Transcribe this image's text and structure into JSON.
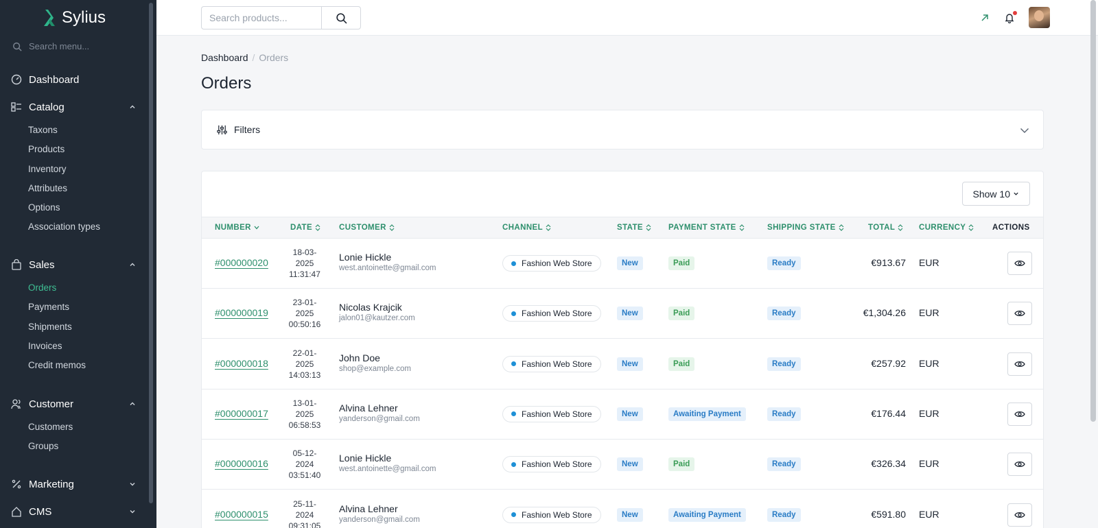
{
  "brand": {
    "name": "Sylius"
  },
  "sidebar": {
    "search_placeholder": "Search menu...",
    "dashboard": "Dashboard",
    "catalog": {
      "label": "Catalog",
      "items": [
        "Taxons",
        "Products",
        "Inventory",
        "Attributes",
        "Options",
        "Association types"
      ]
    },
    "sales": {
      "label": "Sales",
      "items": [
        "Orders",
        "Payments",
        "Shipments",
        "Invoices",
        "Credit memos"
      ],
      "active": "Orders"
    },
    "customer": {
      "label": "Customer",
      "items": [
        "Customers",
        "Groups"
      ]
    },
    "marketing": "Marketing",
    "cms": "CMS"
  },
  "topbar": {
    "search_placeholder": "Search products..."
  },
  "breadcrumb": {
    "root": "Dashboard",
    "current": "Orders"
  },
  "page": {
    "title": "Orders",
    "filters_label": "Filters",
    "show_label": "Show 10"
  },
  "colors": {
    "accent": "#2d8f6c",
    "sidebar": "#212a35",
    "badge_blue": "#2a7cc5",
    "badge_green": "#3a9c56"
  },
  "table": {
    "columns": [
      "NUMBER",
      "DATE",
      "CUSTOMER",
      "CHANNEL",
      "STATE",
      "PAYMENT STATE",
      "SHIPPING STATE",
      "TOTAL",
      "CURRENCY",
      "ACTIONS"
    ],
    "rows": [
      {
        "number": "#000000020",
        "date": [
          "18-03-",
          "2025",
          "11:31:47"
        ],
        "customer": "Lonie Hickle",
        "email": "west.antoinette@gmail.com",
        "channel": "Fashion Web Store",
        "state": "New",
        "payment": "Paid",
        "shipping": "Ready",
        "total": "€913.67",
        "currency": "EUR"
      },
      {
        "number": "#000000019",
        "date": [
          "23-01-",
          "2025",
          "00:50:16"
        ],
        "customer": "Nicolas Krajcik",
        "email": "jalon01@kautzer.com",
        "channel": "Fashion Web Store",
        "state": "New",
        "payment": "Paid",
        "shipping": "Ready",
        "total": "€1,304.26",
        "currency": "EUR"
      },
      {
        "number": "#000000018",
        "date": [
          "22-01-",
          "2025",
          "14:03:13"
        ],
        "customer": "John Doe",
        "email": "shop@example.com",
        "channel": "Fashion Web Store",
        "state": "New",
        "payment": "Paid",
        "shipping": "Ready",
        "total": "€257.92",
        "currency": "EUR"
      },
      {
        "number": "#000000017",
        "date": [
          "13-01-",
          "2025",
          "06:58:53"
        ],
        "customer": "Alvina Lehner",
        "email": "yanderson@gmail.com",
        "channel": "Fashion Web Store",
        "state": "New",
        "payment": "Awaiting Payment",
        "shipping": "Ready",
        "total": "€176.44",
        "currency": "EUR"
      },
      {
        "number": "#000000016",
        "date": [
          "05-12-",
          "2024",
          "03:51:40"
        ],
        "customer": "Lonie Hickle",
        "email": "west.antoinette@gmail.com",
        "channel": "Fashion Web Store",
        "state": "New",
        "payment": "Paid",
        "shipping": "Ready",
        "total": "€326.34",
        "currency": "EUR"
      },
      {
        "number": "#000000015",
        "date": [
          "25-11-",
          "2024",
          "09:31:05"
        ],
        "customer": "Alvina Lehner",
        "email": "yanderson@gmail.com",
        "channel": "Fashion Web Store",
        "state": "New",
        "payment": "Awaiting Payment",
        "shipping": "Ready",
        "total": "€591.80",
        "currency": "EUR"
      }
    ]
  }
}
